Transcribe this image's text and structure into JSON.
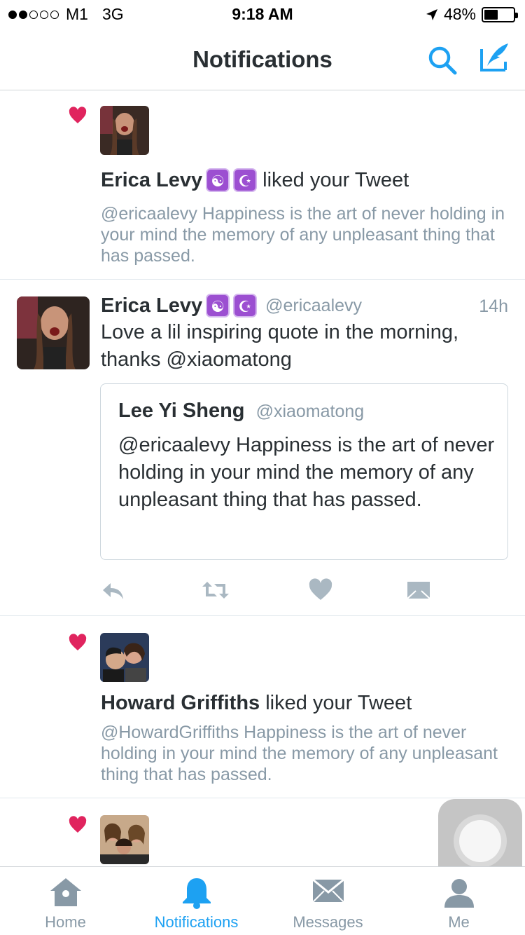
{
  "status_bar": {
    "carrier": "M1",
    "network": "3G",
    "time": "9:18 AM",
    "battery": "48%",
    "battery_level": 0.48
  },
  "nav": {
    "title": "Notifications"
  },
  "colors": {
    "accent": "#1da1f2",
    "like": "#e0245e",
    "muted": "#8899a6",
    "text": "#292f33"
  },
  "notifications": [
    {
      "user": "Erica Levy",
      "emoji": [
        "☯",
        "☪"
      ],
      "action": " liked your Tweet",
      "snippet": "@ericaalevy Happiness is the art of never holding in your mind the memory of any unpleasant thing that has passed."
    },
    {
      "user": "Howard Griffiths",
      "action": " liked your Tweet",
      "snippet": "@HowardGriffiths Happiness is the art of never holding in your mind the memory of any unpleasant thing that has passed."
    }
  ],
  "tweet": {
    "name": "Erica Levy",
    "emoji": [
      "☯",
      "☪"
    ],
    "handle": "@ericaalevy",
    "time": "14h",
    "text": "Love a lil inspiring quote in the morning, thanks @xiaomatong",
    "quote": {
      "name": "Lee Yi Sheng",
      "handle": "@xiaomatong",
      "text": "@ericaalevy Happiness is the art of never holding in your mind the memory of any unpleasant thing that has passed."
    },
    "actions": [
      "reply-icon",
      "retweet-icon",
      "like-icon",
      "direct-message-icon"
    ]
  },
  "tabs": [
    {
      "label": "Home",
      "icon": "home-icon"
    },
    {
      "label": "Notifications",
      "icon": "bell-icon",
      "active": true
    },
    {
      "label": "Messages",
      "icon": "envelope-icon"
    },
    {
      "label": "Me",
      "icon": "person-icon"
    }
  ]
}
